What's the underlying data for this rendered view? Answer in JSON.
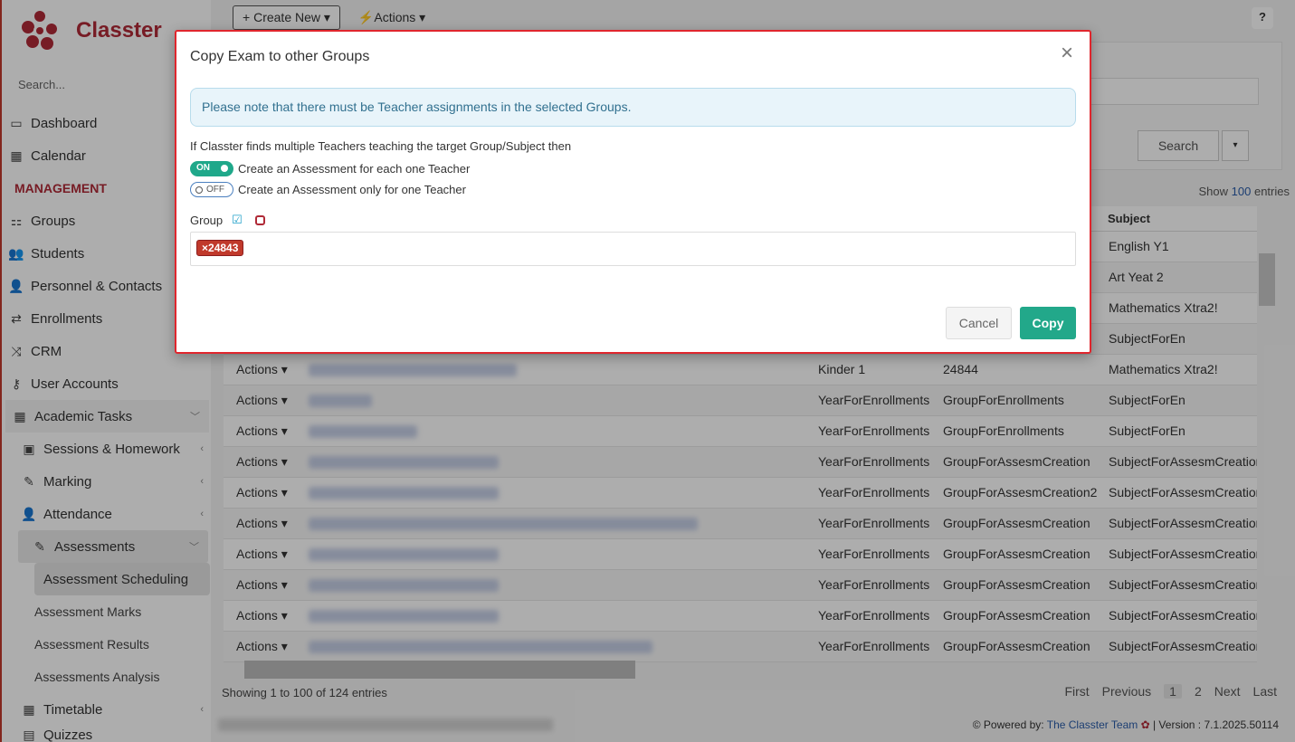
{
  "app": {
    "brand": "Classter"
  },
  "sidebar": {
    "search_placeholder": "Search...",
    "items": [
      {
        "label": "Dashboard"
      },
      {
        "label": "Calendar"
      }
    ],
    "section_management": "MANAGEMENT",
    "mgmt_items": [
      {
        "label": "Groups"
      },
      {
        "label": "Students"
      },
      {
        "label": "Personnel & Contacts"
      },
      {
        "label": "Enrollments"
      },
      {
        "label": "CRM"
      },
      {
        "label": "User Accounts"
      }
    ],
    "academic_tasks": "Academic Tasks",
    "academic_sub": [
      {
        "label": "Sessions & Homework"
      },
      {
        "label": "Marking"
      },
      {
        "label": "Attendance"
      }
    ],
    "assessments": "Assessments",
    "assessment_leaves": [
      {
        "label": "Assessment Scheduling"
      },
      {
        "label": "Assessment Marks"
      },
      {
        "label": "Assessment Results"
      },
      {
        "label": "Assessments Analysis"
      }
    ],
    "timetable": "Timetable",
    "quizzes": "Quizzes"
  },
  "toolbar": {
    "create_new": "Create New",
    "actions": "Actions",
    "help": "?"
  },
  "filters": {
    "search_button": "Search"
  },
  "table": {
    "show_label": "Show",
    "show_value": "100",
    "entries_label": "entries",
    "header_subject": "Subject",
    "rows_top": [
      {
        "subject": "English Y1"
      },
      {
        "subject": "Art Yeat 2"
      },
      {
        "subject": "Mathematics Xtra2!"
      },
      {
        "subject": "SubjectForEn"
      }
    ],
    "rows": [
      {
        "action": "Actions",
        "year": "Kinder 1",
        "group": "24844",
        "subject": "Mathematics Xtra2!"
      },
      {
        "action": "Actions",
        "year": "YearForEnrollments",
        "group": "GroupForEnrollments",
        "subject": "SubjectForEn"
      },
      {
        "action": "Actions",
        "year": "YearForEnrollments",
        "group": "GroupForEnrollments",
        "subject": "SubjectForEn"
      },
      {
        "action": "Actions",
        "year": "YearForEnrollments",
        "group": "GroupForAssesmCreation",
        "subject": "SubjectForAssesmCreation"
      },
      {
        "action": "Actions",
        "year": "YearForEnrollments",
        "group": "GroupForAssesmCreation2",
        "subject": "SubjectForAssesmCreation"
      },
      {
        "action": "Actions",
        "year": "YearForEnrollments",
        "group": "GroupForAssesmCreation",
        "subject": "SubjectForAssesmCreation"
      },
      {
        "action": "Actions",
        "year": "YearForEnrollments",
        "group": "GroupForAssesmCreation",
        "subject": "SubjectForAssesmCreation"
      },
      {
        "action": "Actions",
        "year": "YearForEnrollments",
        "group": "GroupForAssesmCreation",
        "subject": "SubjectForAssesmCreation"
      },
      {
        "action": "Actions",
        "year": "YearForEnrollments",
        "group": "GroupForAssesmCreation",
        "subject": "SubjectForAssesmCreation"
      },
      {
        "action": "Actions",
        "year": "YearForEnrollments",
        "group": "GroupForAssesmCreation",
        "subject": "SubjectForAssesmCreation"
      }
    ],
    "info": "Showing 1 to 100 of 124 entries",
    "pager": {
      "first": "First",
      "previous": "Previous",
      "p1": "1",
      "p2": "2",
      "next": "Next",
      "last": "Last"
    }
  },
  "footer": {
    "powered_by": "Powered by:",
    "team": "The Classter Team",
    "version": "| Version : 7.1.2025.50114"
  },
  "modal": {
    "title": "Copy Exam to other Groups",
    "alert": "Please note that there must be Teacher assignments in the selected Groups.",
    "question": "If Classter finds multiple Teachers teaching the target Group/Subject then",
    "option_on_state": "ON",
    "option_on_label": "Create an Assessment for each one Teacher",
    "option_off_state": "OFF",
    "option_off_label": "Create an Assessment only for one Teacher",
    "group_label": "Group",
    "tag_value": "24843",
    "cancel": "Cancel",
    "copy": "Copy"
  },
  "colors": {
    "brand": "#b02a37",
    "accent": "#22a88a",
    "modal_border": "#e0262d",
    "alert_bg": "#e8f4fa"
  }
}
